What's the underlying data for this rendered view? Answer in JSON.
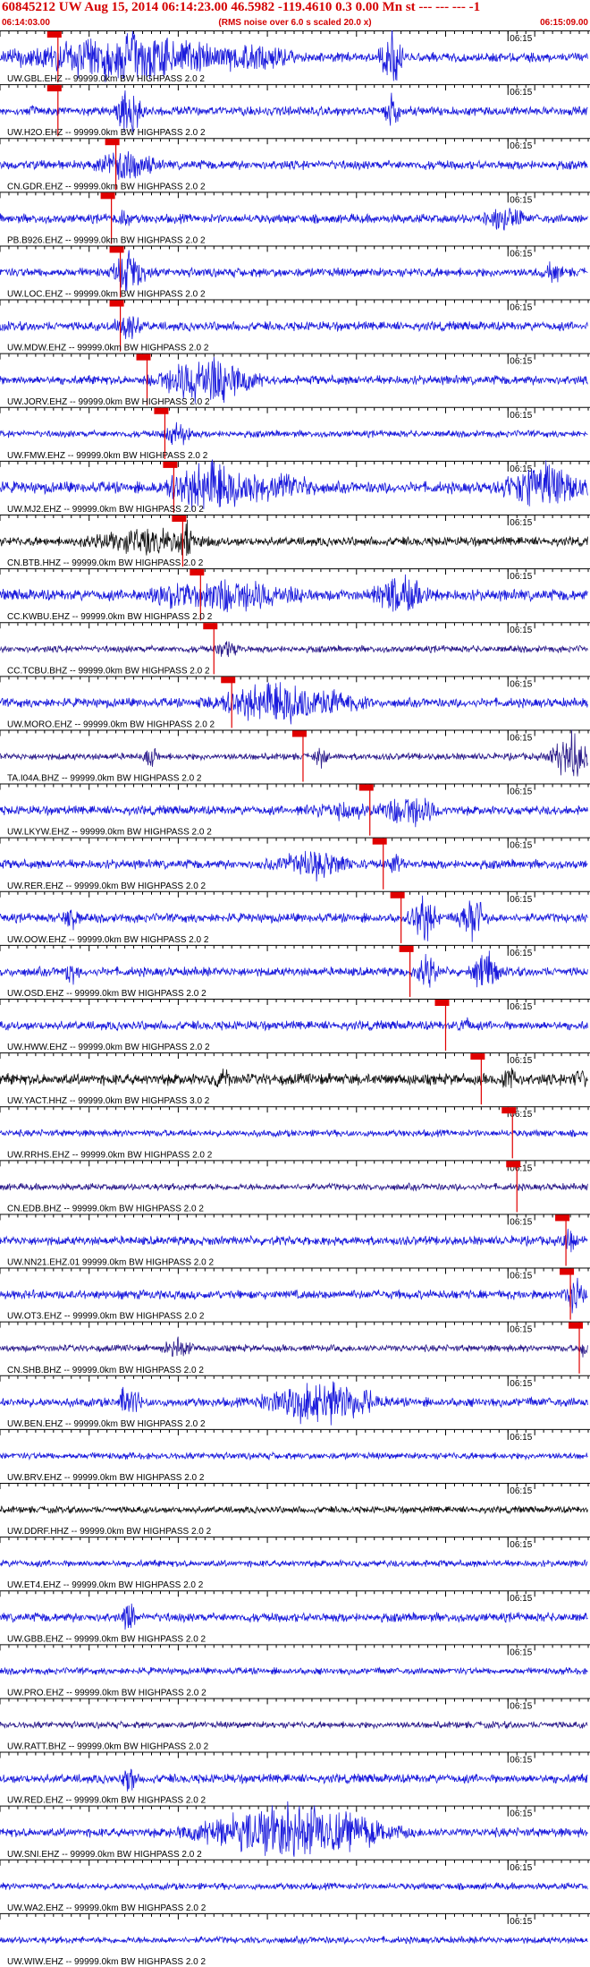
{
  "header": {
    "title": "60845212 UW Aug 15, 2014 06:14:23.00   46.5982 -119.4610  0.3 0.00 Mn st --- --- ---  -1",
    "start_time": "06:14:03.00",
    "rms_note": "(RMS noise over 6.0 s scaled 20.0 x)",
    "end_time": "06:15:09.00"
  },
  "chart_data": {
    "type": "line",
    "x_range_seconds": [
      0,
      66
    ],
    "minute_mark_label": "06:15",
    "minute_mark_seconds": 57,
    "traces": [
      {
        "label": "UW.GBL.EHZ -- 99999.0km BW  HIGHPASS  2.0  2",
        "color": "#1a1adc",
        "pick_s": 6.5,
        "amp": 4,
        "bursts": [
          [
            14.5,
            16,
            26
          ],
          [
            29.5,
            4.5,
            12
          ],
          [
            44,
            1.8,
            30
          ]
        ]
      },
      {
        "label": "UW.H2O.EHZ -- 99999.0km BW  HIGHPASS  2.0  2",
        "color": "#1a1adc",
        "pick_s": 6.5,
        "amp": 4,
        "bursts": [
          [
            14.5,
            2,
            26
          ],
          [
            44,
            1,
            26
          ]
        ]
      },
      {
        "label": "CN.GDR.EHZ -- 99999.0km BW  HIGHPASS  2.0  2",
        "color": "#1a1adc",
        "pick_s": 13,
        "amp": 4,
        "bursts": [
          [
            14,
            4,
            18
          ]
        ]
      },
      {
        "label": "PB.B926.EHZ -- 99999.0km BW  HIGHPASS  2.0  2",
        "color": "#1a1adc",
        "pick_s": 12.5,
        "amp": 4,
        "bursts": [
          [
            14,
            1,
            10
          ],
          [
            56,
            2,
            16
          ],
          [
            58,
            1,
            12
          ]
        ]
      },
      {
        "label": "UW.LOC.EHZ -- 99999.0km BW  HIGHPASS  2.0  2",
        "color": "#1a1adc",
        "pick_s": 13.5,
        "amp": 4,
        "bursts": [
          [
            14.5,
            2.5,
            22
          ],
          [
            62,
            1.5,
            8
          ]
        ]
      },
      {
        "label": "UW.MDW.EHZ -- 99999.0km BW  HIGHPASS  2.0  2",
        "color": "#1a1adc",
        "pick_s": 13.5,
        "amp": 4,
        "bursts": [
          [
            14.5,
            2,
            14
          ]
        ]
      },
      {
        "label": "UW.JORV.EHZ -- 99999.0km BW  HIGHPASS  2.0  2",
        "color": "#1a1adc",
        "pick_s": 16.5,
        "amp": 4,
        "bursts": [
          [
            23,
            7,
            28
          ]
        ]
      },
      {
        "label": "UW.FMW.EHZ -- 99999.0km BW  HIGHPASS  2.0  2",
        "color": "#1a1adc",
        "pick_s": 18.5,
        "amp": 3,
        "bursts": [
          [
            20,
            2,
            14
          ]
        ]
      },
      {
        "label": "UW.MJ2.EHZ -- 99999.0km BW  HIGHPASS  2.0  2",
        "color": "#1a1adc",
        "pick_s": 19.5,
        "amp": 5,
        "bursts": [
          [
            24,
            7,
            28
          ],
          [
            32,
            4,
            14
          ],
          [
            61,
            6,
            24
          ]
        ]
      },
      {
        "label": "CN.BTB.HHZ -- 99999.0km BW  HIGHPASS  2.0  2",
        "color": "#111111",
        "pick_s": 20.5,
        "amp": 4,
        "bursts": [
          [
            16,
            8,
            12
          ],
          [
            21,
            1,
            18
          ]
        ]
      },
      {
        "label": "CC.KWBU.EHZ -- 99999.0km BW  HIGHPASS  2.0  2",
        "color": "#1a1adc",
        "pick_s": 22.5,
        "amp": 5,
        "bursts": [
          [
            26,
            9,
            18
          ],
          [
            45,
            4,
            20
          ],
          [
            18,
            3,
            10
          ]
        ]
      },
      {
        "label": "CC.TCBU.BHZ -- 99999.0km BW  HIGHPASS  2.0  2",
        "color": "#2a1a8a",
        "pick_s": 24,
        "amp": 3,
        "bursts": [
          [
            25.5,
            1.5,
            10
          ]
        ]
      },
      {
        "label": "UW.MORO.EHZ -- 99999.0km BW  HIGHPASS  2.0  2",
        "color": "#1a1adc",
        "pick_s": 26,
        "amp": 4,
        "bursts": [
          [
            32,
            10,
            24
          ]
        ]
      },
      {
        "label": "TA.I04A.BHZ -- 99999.0km BW  HIGHPASS  2.0  2",
        "color": "#2a1a8a",
        "pick_s": 34,
        "amp": 3,
        "bursts": [
          [
            17,
            1,
            12
          ],
          [
            36,
            1,
            12
          ],
          [
            64,
            3,
            26
          ]
        ]
      },
      {
        "label": "UW.LKYW.EHZ -- 99999.0km BW  HIGHPASS  2.0  2",
        "color": "#1a1adc",
        "pick_s": 41.5,
        "amp": 4,
        "bursts": [
          [
            46,
            4,
            20
          ],
          [
            38,
            5,
            8
          ]
        ]
      },
      {
        "label": "UW.RER.EHZ -- 99999.0km BW  HIGHPASS  2.0  2",
        "color": "#1a1adc",
        "pick_s": 43,
        "amp": 4,
        "bursts": [
          [
            35,
            6,
            14
          ],
          [
            44.5,
            1,
            14
          ]
        ]
      },
      {
        "label": "UW.OOW.EHZ -- 99999.0km BW  HIGHPASS  2.0  2",
        "color": "#1a1adc",
        "pick_s": 45,
        "amp": 4,
        "bursts": [
          [
            8,
            1,
            16
          ],
          [
            47.5,
            2,
            26
          ],
          [
            53,
            2,
            26
          ]
        ]
      },
      {
        "label": "UW.OSD.EHZ -- 99999.0km BW  HIGHPASS  2.0  2",
        "color": "#1a1adc",
        "pick_s": 46,
        "amp": 4,
        "bursts": [
          [
            8,
            1,
            14
          ],
          [
            48,
            1.5,
            22
          ],
          [
            54.5,
            2,
            22
          ]
        ]
      },
      {
        "label": "UW.HWW.EHZ -- 99999.0km BW  HIGHPASS  2.0  2",
        "color": "#1a1adc",
        "pick_s": 50,
        "amp": 4,
        "bursts": [
          [
            52,
            1,
            8
          ]
        ]
      },
      {
        "label": "UW.YACT.HHZ -- 99999.0km BW  HIGHPASS  3.0  2",
        "color": "#111111",
        "pick_s": 54,
        "amp": 5,
        "bursts": [
          [
            57,
            1,
            18
          ],
          [
            25,
            1,
            10
          ],
          [
            65,
            1,
            10
          ]
        ]
      },
      {
        "label": "UW.RRHS.EHZ -- 99999.0km BW  HIGHPASS  2.0  2",
        "color": "#1a1adc",
        "pick_s": 57.5,
        "amp": 3,
        "bursts": []
      },
      {
        "label": "CN.EDB.BHZ -- 99999.0km BW  HIGHPASS  2.0  2",
        "color": "#2a1a8a",
        "pick_s": 58,
        "amp": 3,
        "bursts": []
      },
      {
        "label": "UW.NN21.EHZ.01 99999.0km BW  HIGHPASS  2.0  2",
        "color": "#1a1adc",
        "pick_s": 63.5,
        "amp": 4,
        "bursts": [
          [
            64,
            1,
            14
          ]
        ]
      },
      {
        "label": "UW.OT3.EHZ -- 99999.0km BW  HIGHPASS  2.0  2",
        "color": "#1a1adc",
        "pick_s": 64,
        "amp": 4,
        "bursts": [
          [
            64.5,
            1.5,
            18
          ]
        ]
      },
      {
        "label": "CN.SHB.BHZ -- 99999.0km BW  HIGHPASS  2.0  2",
        "color": "#2a1a8a",
        "pick_s": 65,
        "amp": 3,
        "bursts": [
          [
            20,
            2,
            12
          ],
          [
            65.5,
            0.5,
            10
          ]
        ]
      },
      {
        "label": "UW.BEN.EHZ -- 99999.0km BW  HIGHPASS  2.0  2",
        "color": "#1a1adc",
        "pick_s": null,
        "amp": 4,
        "bursts": [
          [
            14.5,
            1.5,
            22
          ],
          [
            36,
            8,
            26
          ]
        ]
      },
      {
        "label": "UW.BRV.EHZ -- 99999.0km BW  HIGHPASS  2.0  2",
        "color": "#1a1adc",
        "pick_s": null,
        "amp": 3,
        "bursts": []
      },
      {
        "label": "UW.DDRF.HHZ -- 99999.0km BW  HIGHPASS  2.0  2",
        "color": "#111111",
        "pick_s": null,
        "amp": 3,
        "bursts": []
      },
      {
        "label": "UW.ET4.EHZ -- 99999.0km BW  HIGHPASS  2.0  2",
        "color": "#1a1adc",
        "pick_s": null,
        "amp": 3,
        "bursts": []
      },
      {
        "label": "UW.GBB.EHZ -- 99999.0km BW  HIGHPASS  2.0  2",
        "color": "#1a1adc",
        "pick_s": null,
        "amp": 4,
        "bursts": [
          [
            14.5,
            1,
            16
          ]
        ]
      },
      {
        "label": "UW.PRO.EHZ -- 99999.0km BW  HIGHPASS  2.0  2",
        "color": "#1a1adc",
        "pick_s": null,
        "amp": 3,
        "bursts": []
      },
      {
        "label": "UW.RATT.BHZ -- 99999.0km BW  HIGHPASS  2.0  2",
        "color": "#2a1a8a",
        "pick_s": null,
        "amp": 3,
        "bursts": []
      },
      {
        "label": "UW.RED.EHZ -- 99999.0km BW  HIGHPASS  2.0  2",
        "color": "#1a1adc",
        "pick_s": null,
        "amp": 4,
        "bursts": [
          [
            14.5,
            1,
            16
          ]
        ]
      },
      {
        "label": "UW.SNI.EHZ -- 99999.0km BW  HIGHPASS  2.0  2",
        "color": "#1a1adc",
        "pick_s": null,
        "amp": 4,
        "bursts": [
          [
            33,
            14,
            30
          ]
        ]
      },
      {
        "label": "UW.WA2.EHZ -- 99999.0km BW  HIGHPASS  2.0  2",
        "color": "#1a1adc",
        "pick_s": null,
        "amp": 3,
        "bursts": []
      },
      {
        "label": "UW.WIW.EHZ -- 99999.0km BW  HIGHPASS  2.0  2",
        "color": "#1a1adc",
        "pick_s": null,
        "amp": 3,
        "bursts": []
      }
    ]
  }
}
